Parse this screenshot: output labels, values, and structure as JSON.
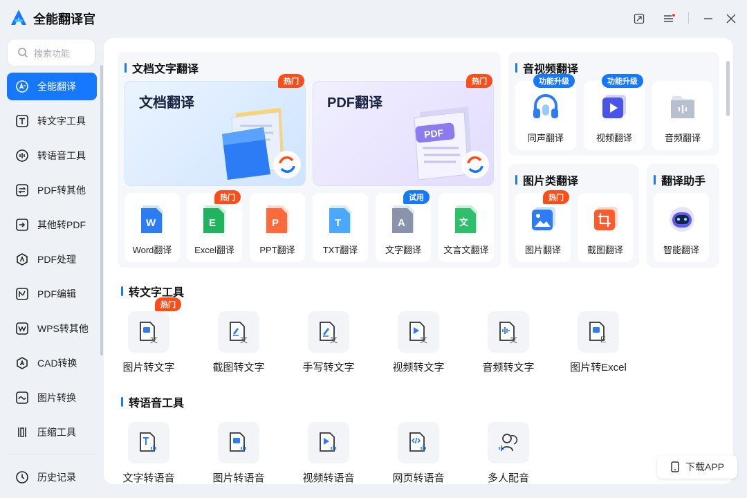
{
  "app": {
    "title": "全能翻译官"
  },
  "search": {
    "placeholder": "搜索功能"
  },
  "sidebar": {
    "items": [
      {
        "label": "全能翻译",
        "icon": "translate-icon"
      },
      {
        "label": "转文字工具",
        "icon": "text-tool-icon"
      },
      {
        "label": "转语音工具",
        "icon": "voice-tool-icon"
      },
      {
        "label": "PDF转其他",
        "icon": "pdf-convert-icon"
      },
      {
        "label": "其他转PDF",
        "icon": "to-pdf-icon"
      },
      {
        "label": "PDF处理",
        "icon": "pdf-process-icon"
      },
      {
        "label": "PDF编辑",
        "icon": "pdf-edit-icon"
      },
      {
        "label": "WPS转其他",
        "icon": "wps-convert-icon"
      },
      {
        "label": "CAD转换",
        "icon": "cad-icon"
      },
      {
        "label": "图片转换",
        "icon": "image-convert-icon"
      },
      {
        "label": "压缩工具",
        "icon": "compress-icon"
      }
    ],
    "history": "历史记录"
  },
  "doc_section": {
    "title": "文档文字翻译",
    "big_cards": [
      {
        "label": "文档翻译",
        "tag": "热门"
      },
      {
        "label": "PDF翻译",
        "tag": "热门"
      }
    ],
    "tiles": [
      {
        "label": "Word翻译",
        "letter": "W",
        "tag": ""
      },
      {
        "label": "Excel翻译",
        "letter": "E",
        "tag": "热门"
      },
      {
        "label": "PPT翻译",
        "letter": "P",
        "tag": ""
      },
      {
        "label": "TXT翻译",
        "letter": "T",
        "tag": ""
      },
      {
        "label": "文字翻译",
        "letter": "A",
        "tag": "试用"
      },
      {
        "label": "文言文翻译",
        "letter": "文",
        "tag": ""
      }
    ]
  },
  "av_section": {
    "title": "音视频翻译",
    "tiles": [
      {
        "label": "同声翻译",
        "tag": "功能升级"
      },
      {
        "label": "视频翻译",
        "tag": "功能升级"
      },
      {
        "label": "音频翻译",
        "tag": ""
      }
    ]
  },
  "img_section": {
    "title": "图片类翻译",
    "tiles": [
      {
        "label": "图片翻译",
        "tag": "热门"
      },
      {
        "label": "截图翻译",
        "tag": ""
      }
    ]
  },
  "assistant_section": {
    "title": "翻译助手",
    "tiles": [
      {
        "label": "智能翻译"
      }
    ]
  },
  "text_tools": {
    "title": "转文字工具",
    "hot_tag": "热门",
    "items": [
      {
        "label": "图片转文字",
        "badge": "文"
      },
      {
        "label": "截图转文字",
        "badge": "文"
      },
      {
        "label": "手写转文字",
        "badge": "文"
      },
      {
        "label": "视频转文字",
        "badge": "文"
      },
      {
        "label": "音频转文字",
        "badge": "文"
      },
      {
        "label": "图片转Excel",
        "badge": "E"
      }
    ]
  },
  "voice_tools": {
    "title": "转语音工具",
    "items": [
      {
        "label": "文字转语音"
      },
      {
        "label": "图片转语音"
      },
      {
        "label": "视频转语音"
      },
      {
        "label": "网页转语音"
      },
      {
        "label": "多人配音"
      }
    ]
  },
  "download": {
    "label": "下载APP"
  },
  "colors": {
    "accent": "#1677ff",
    "hot": "#ff4d1a",
    "panel": "#f5f7fa"
  }
}
